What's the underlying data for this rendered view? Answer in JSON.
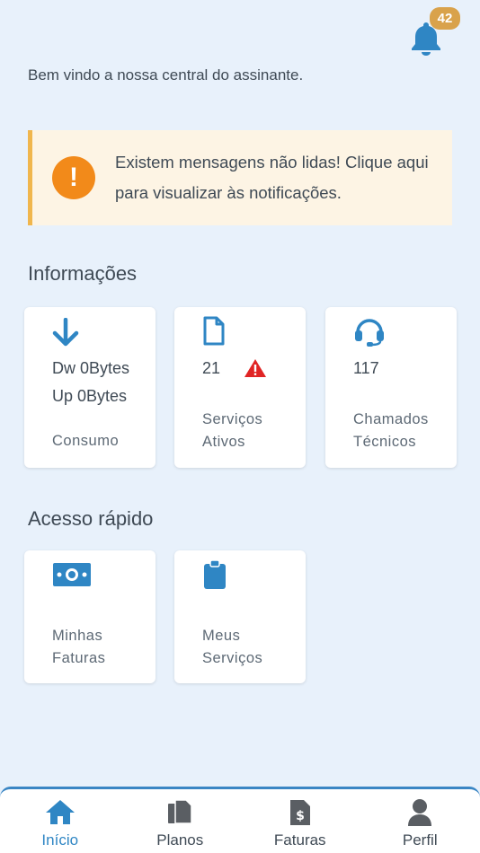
{
  "notifications": {
    "count": "42"
  },
  "welcome_text": "Bem vindo a nossa central do assinante.",
  "alert": {
    "icon_glyph": "!",
    "text": "Existem mensagens não lidas! Clique aqui para visualizar às notificações."
  },
  "info": {
    "title": "Informações",
    "consumo": {
      "line1": "Dw 0Bytes",
      "line2": "Up 0Bytes",
      "label": "Consumo"
    },
    "servicos": {
      "value": "21",
      "label_1": "Serviços",
      "label_2": "Ativos"
    },
    "chamados": {
      "value": "117",
      "label_1": "Chamados",
      "label_2": "Técnicos"
    }
  },
  "quick": {
    "title": "Acesso rápido",
    "faturas": {
      "label_1": "Minhas",
      "label_2": "Faturas"
    },
    "servicos": {
      "label_1": "Meus",
      "label_2": "Serviços"
    }
  },
  "nav": {
    "inicio": "Início",
    "planos": "Planos",
    "faturas": "Faturas",
    "perfil": "Perfil"
  },
  "colors": {
    "accent": "#2f86c4",
    "badge": "#d9a24b",
    "alert_icon": "#f28a1a",
    "alert_border": "#f0b64d",
    "warning": "#e02424"
  }
}
